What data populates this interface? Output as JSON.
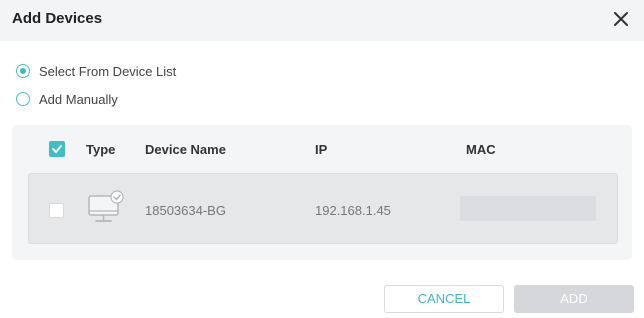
{
  "dialog": {
    "title": "Add Devices",
    "close_icon": "close-icon"
  },
  "options": [
    {
      "label": "Select From Device List",
      "selected": true
    },
    {
      "label": "Add Manually",
      "selected": false
    }
  ],
  "table": {
    "columns": [
      "Type",
      "Device Name",
      "IP",
      "MAC"
    ],
    "header_checked": true,
    "rows": [
      {
        "type_icon": "computer-icon",
        "device_name": "18503634-BG",
        "ip": "192.168.1.45",
        "mac": "",
        "checked": false
      }
    ]
  },
  "buttons": {
    "cancel": "CANCEL",
    "add": "ADD"
  },
  "colors": {
    "accent": "#3fb8c2",
    "header_bg": "#f3f4f6",
    "panel_bg": "#f4f5f7",
    "row_bg": "#e6e7e9",
    "disabled_button": "#d6d7da"
  }
}
